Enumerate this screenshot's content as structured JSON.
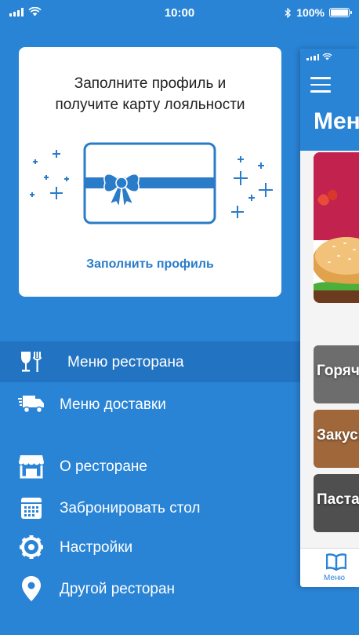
{
  "status_bar": {
    "time": "10:00",
    "battery": "100%",
    "battery_level": 1.0
  },
  "promo_card": {
    "title": "Заполните профиль и\nполучите карту лояльности",
    "link_label": "Заполнить профиль"
  },
  "menu": {
    "items": [
      {
        "label": "Меню ресторана",
        "icon": "dining-icon",
        "active": true
      },
      {
        "label": "Меню доставки",
        "icon": "delivery-truck-icon",
        "active": false
      },
      {
        "label": "О ресторане",
        "icon": "store-icon",
        "active": false
      },
      {
        "label": "Забронировать стол",
        "icon": "calendar-icon",
        "active": false
      },
      {
        "label": "Настройки",
        "icon": "gear-icon",
        "active": false
      },
      {
        "label": "Другой ресторан",
        "icon": "location-pin-icon",
        "active": false
      }
    ]
  },
  "preview": {
    "title": "Меню",
    "categories": [
      "Горячее",
      "Закуски",
      "Паста"
    ],
    "tab_label": "Меню"
  },
  "colors": {
    "background": "#2a84d6",
    "active_item": "#2274c2",
    "accent": "#2a7cc9",
    "card": "#ffffff"
  }
}
